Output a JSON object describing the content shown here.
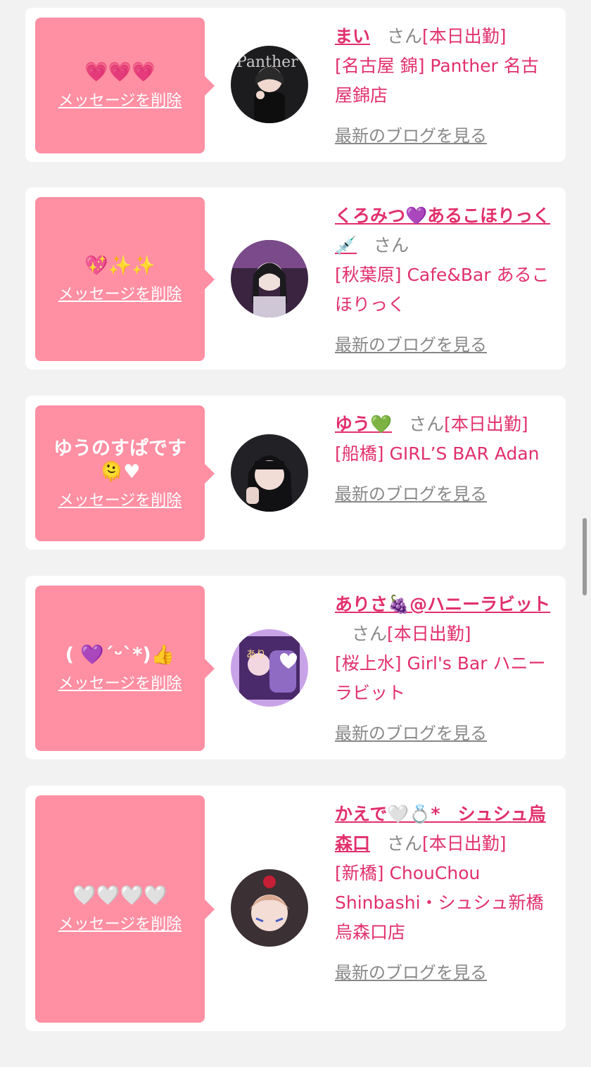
{
  "colors": {
    "page_bg": "#f2f2f2",
    "card_bg": "#ffffff",
    "bubble_pink": "#ff8fa3",
    "accent": "#e1306c",
    "muted_gray": "#888888"
  },
  "cards": [
    {
      "message": "💗💗💗",
      "delete_label": "メッセージを削除",
      "name": "まい",
      "san": "さん",
      "status": "[本日出勤]",
      "shop": "[名古屋 錦] Panther 名古屋錦店",
      "blog_link": "最新のブログを見る"
    },
    {
      "message": "💖✨✨",
      "delete_label": "メッセージを削除",
      "name": "くろみつ💜あるこほりっく💉",
      "san": "さん",
      "status": "",
      "shop": "[秋葉原] Cafe&Bar あるこほりっく",
      "blog_link": "最新のブログを見る"
    },
    {
      "message": "ゆうのすぱです🫠♥",
      "delete_label": "メッセージを削除",
      "name": "ゆう💚",
      "san": "さん",
      "status": "[本日出勤]",
      "shop": "[船橋] GIRL’S BAR Adan",
      "blog_link": "最新のブログを見る"
    },
    {
      "message": "( 💜´ᵕ`*)👍",
      "delete_label": "メッセージを削除",
      "name": "ありさ🍇@ハニーラビット",
      "san": "さん",
      "status": "[本日出勤]",
      "shop": "[桜上水] Girl's Bar ハニーラビット",
      "blog_link": "最新のブログを見る"
    },
    {
      "message": "🤍🤍🤍🤍",
      "delete_label": "メッセージを削除",
      "name": "かえで🤍💍*　シュシュ烏森口",
      "san": "さん",
      "status": "[本日出勤]",
      "shop": "[新橋] ChouChou Shinbashi・シュシュ新橋烏森口店",
      "blog_link": "最新のブログを見る"
    }
  ]
}
